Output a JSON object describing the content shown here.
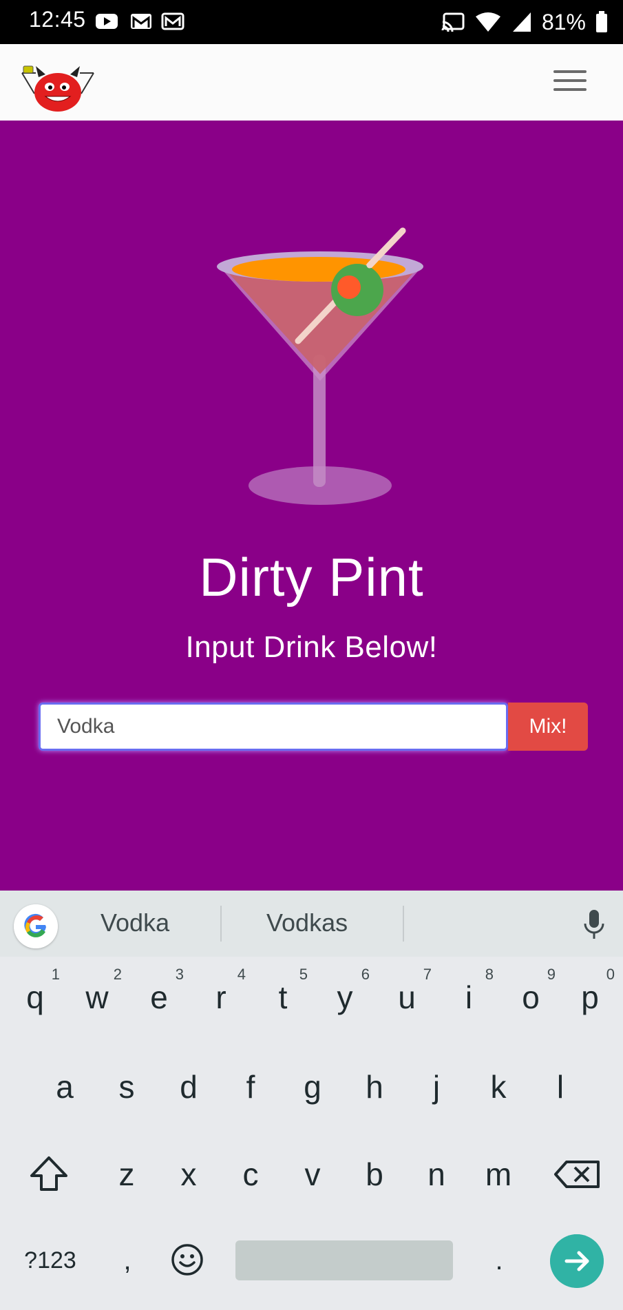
{
  "status_bar": {
    "time": "12:45",
    "notification_icons": [
      "youtube-icon",
      "gmail-icon",
      "gmail-icon"
    ],
    "system_icons": [
      "cast-icon",
      "wifi-icon",
      "signal-icon",
      "battery-icon"
    ],
    "battery": "81%"
  },
  "header": {
    "logo_icon": "devil-mascot-logo",
    "menu_icon": "hamburger-menu-icon"
  },
  "hero": {
    "title": "Dirty Pint",
    "subtitle": "Input Drink Below!",
    "illustration": "martini-glass-with-olive",
    "input_value": "Vodka",
    "mix_button_label": "Mix!",
    "background_color": "#8a0088",
    "button_color": "#e24a44"
  },
  "keyboard": {
    "suggestions": [
      "Vodka",
      "Vodkas"
    ],
    "row1": [
      {
        "key": "q",
        "num": "1"
      },
      {
        "key": "w",
        "num": "2"
      },
      {
        "key": "e",
        "num": "3"
      },
      {
        "key": "r",
        "num": "4"
      },
      {
        "key": "t",
        "num": "5"
      },
      {
        "key": "y",
        "num": "6"
      },
      {
        "key": "u",
        "num": "7"
      },
      {
        "key": "i",
        "num": "8"
      },
      {
        "key": "o",
        "num": "9"
      },
      {
        "key": "p",
        "num": "0"
      }
    ],
    "row2": [
      "a",
      "s",
      "d",
      "f",
      "g",
      "h",
      "j",
      "k",
      "l"
    ],
    "row3": [
      "z",
      "x",
      "c",
      "v",
      "b",
      "n",
      "m"
    ],
    "symbols_label": "?123",
    "comma": ",",
    "period": ".",
    "enter_color": "#30b3a5"
  }
}
